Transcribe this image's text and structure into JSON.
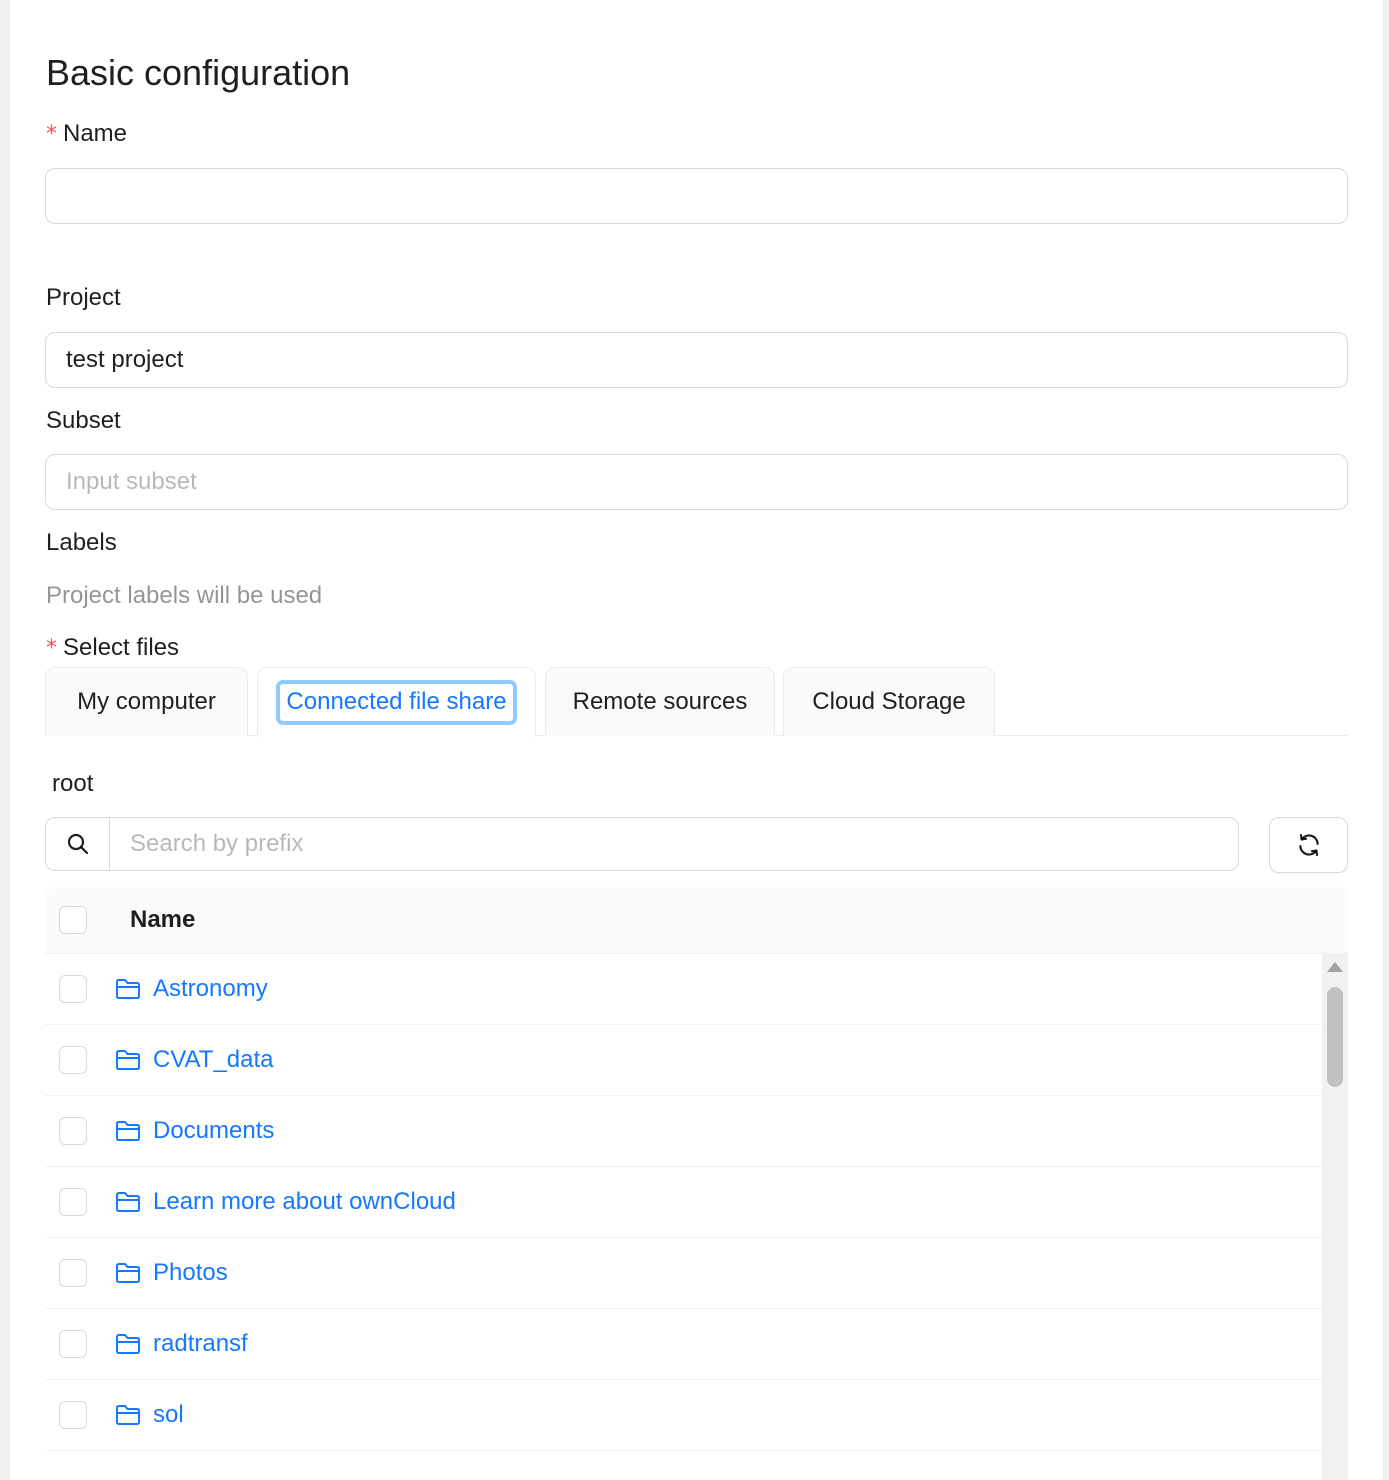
{
  "form": {
    "title": "Basic configuration",
    "required_mark": "*",
    "name": {
      "label": "Name",
      "value": "",
      "placeholder": ""
    },
    "project": {
      "label": "Project",
      "value": "test project"
    },
    "subset": {
      "label": "Subset",
      "placeholder": "Input subset",
      "value": ""
    },
    "labels": {
      "label": "Labels",
      "hint": "Project labels will be used"
    },
    "select_files": {
      "label": "Select files"
    }
  },
  "tabs": [
    {
      "label": "My computer",
      "active": false
    },
    {
      "label": "Connected file share",
      "active": true
    },
    {
      "label": "Remote sources",
      "active": false
    },
    {
      "label": "Cloud Storage",
      "active": false
    }
  ],
  "browser": {
    "breadcrumb": "root",
    "search": {
      "placeholder": "Search by prefix",
      "value": "",
      "icon": "search-icon"
    },
    "refresh": {
      "icon": "reload-icon"
    },
    "table": {
      "header": "Name",
      "rows": [
        {
          "name": "Astronomy",
          "type": "folder"
        },
        {
          "name": "CVAT_data",
          "type": "folder"
        },
        {
          "name": "Documents",
          "type": "folder"
        },
        {
          "name": "Learn more about ownCloud",
          "type": "folder"
        },
        {
          "name": "Photos",
          "type": "folder"
        },
        {
          "name": "radtransf",
          "type": "folder"
        },
        {
          "name": "sol",
          "type": "folder"
        }
      ]
    }
  },
  "colors": {
    "accent": "#1677ff",
    "focus_ring": "#91caff",
    "required": "#ff4d4f",
    "border": "#d9d9d9"
  }
}
